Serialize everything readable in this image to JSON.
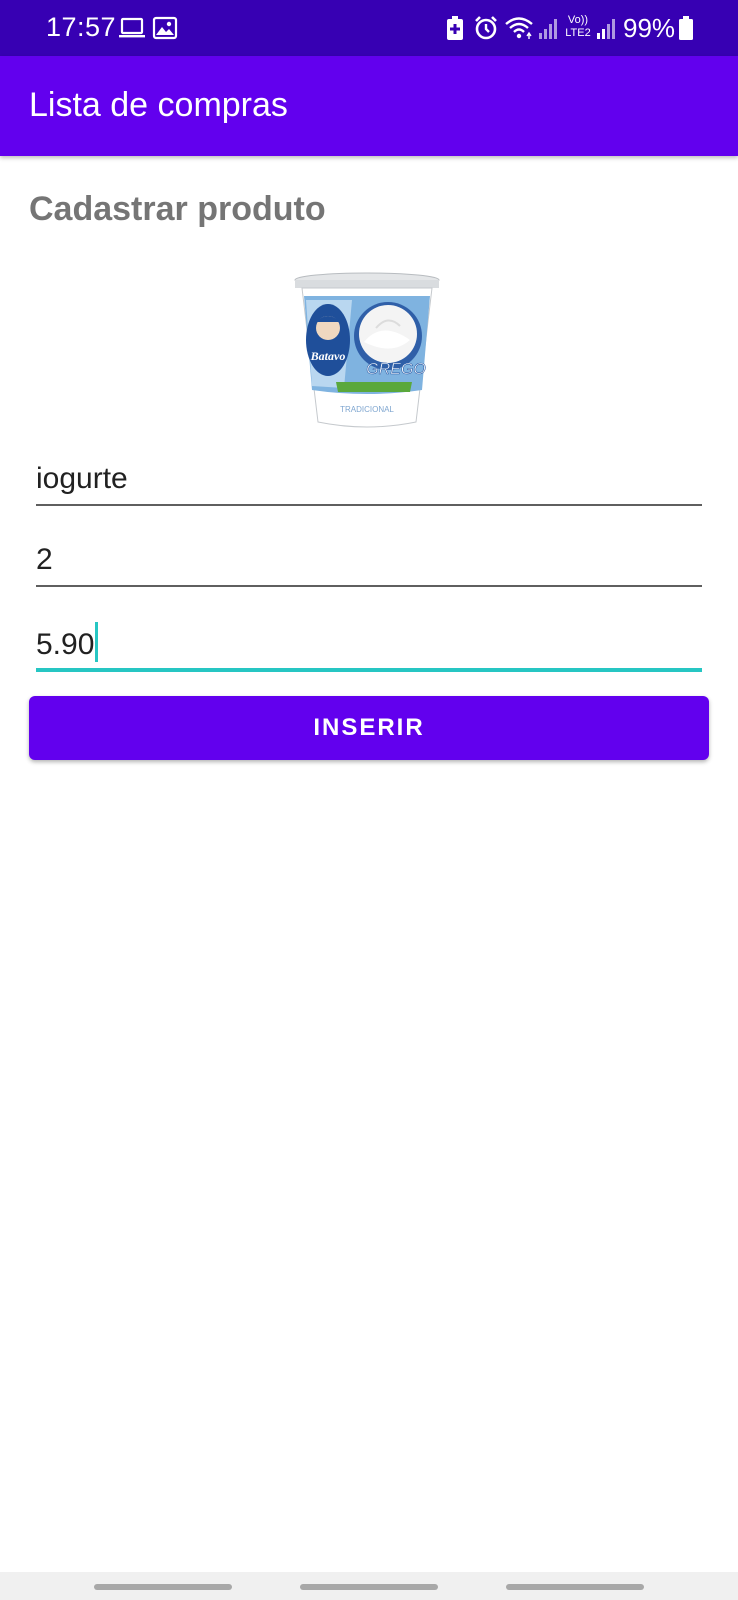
{
  "status_bar": {
    "time": "17:57",
    "battery": "99%",
    "network_label": "Vo)) LTE2",
    "icons": [
      "laptop-icon",
      "image-icon",
      "battery-saver-icon",
      "alarm-icon",
      "wifi-icon",
      "signal-icon",
      "volte-lte-icon",
      "signal-icon",
      "battery-icon"
    ]
  },
  "app_bar": {
    "title": "Lista de compras"
  },
  "form": {
    "title": "Cadastrar produto",
    "product_image": "yogurt-product-image",
    "product_image_text": [
      "Batavo",
      "GREGO",
      "TRADICIONAL"
    ],
    "fields": [
      {
        "value": "iogurte"
      },
      {
        "value": "2"
      },
      {
        "value": "5.90",
        "focused": true
      }
    ],
    "submit_label": "INSERIR"
  },
  "colors": {
    "status_bar": "#3700b3",
    "primary": "#6200ee",
    "accent": "#26c6c3",
    "section_title": "#757575"
  }
}
